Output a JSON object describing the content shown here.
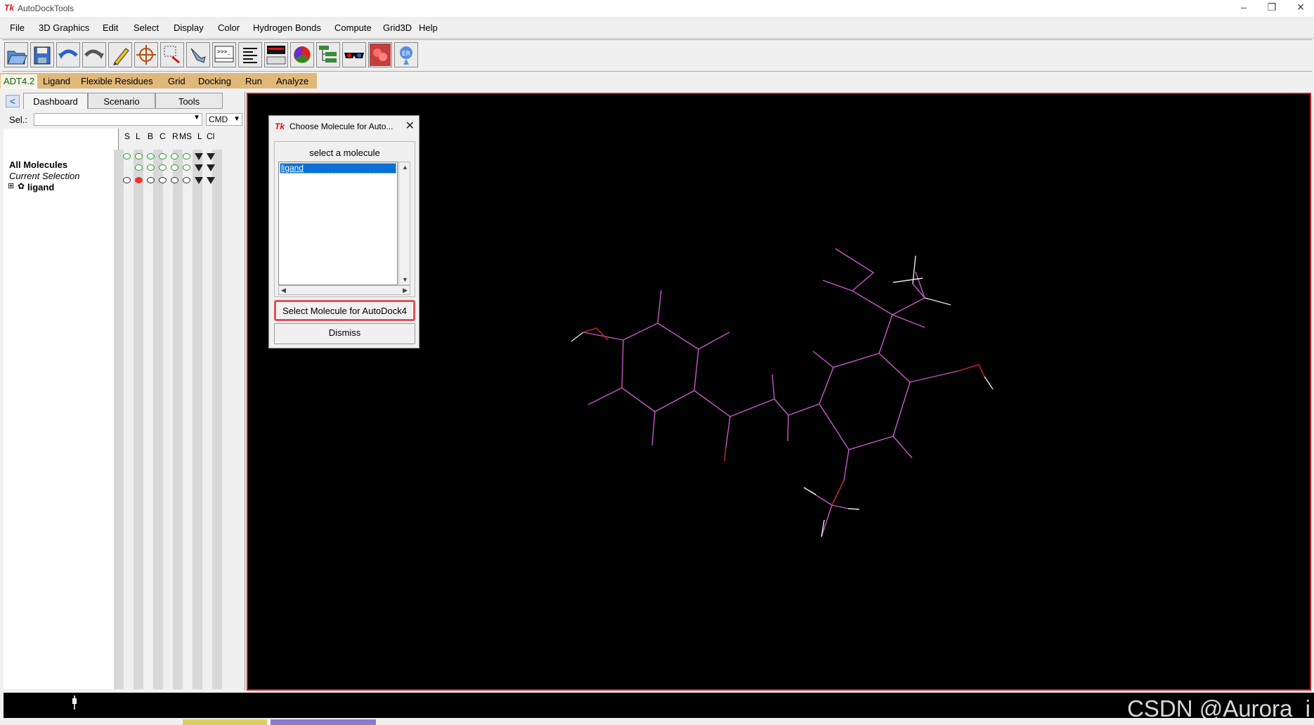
{
  "window": {
    "title": "AutoDockTools",
    "app_icon": "Tk"
  },
  "menubar": [
    "File",
    "3D Graphics",
    "Edit",
    "Select",
    "Display",
    "Color",
    "Hydrogen Bonds",
    "Compute",
    "Grid3D",
    "Help"
  ],
  "toolbar_icons": [
    "open-file-icon",
    "save-icon",
    "undo-icon",
    "redo-icon",
    "pencil-icon",
    "crosshair-icon",
    "select-region-icon",
    "pick-hand-icon",
    "python-shell-icon",
    "text-align-icon",
    "display-panel-icon",
    "color-sphere-icon",
    "hierarchy-icon",
    "stereo-glasses-icon",
    "red-molecule-icon",
    "info-icon"
  ],
  "adt_menu": {
    "version": "ADT4.2",
    "items": [
      "Ligand",
      "Flexible Residues",
      "Grid",
      "Docking",
      "Run",
      "Analyze"
    ]
  },
  "dashboard": {
    "tabs": [
      "Dashboard",
      "Scenario",
      "Tools"
    ],
    "sel_label": "Sel.:",
    "sel_value": "",
    "cmd_value": "CMD",
    "columns": [
      "S",
      "L",
      "B",
      "C",
      "R",
      "MS",
      "L",
      "Cl"
    ],
    "tree": [
      {
        "label": "All Molecules",
        "style": "bold"
      },
      {
        "label": "Current Selection",
        "style": "italic"
      },
      {
        "label": "ligand",
        "style": "bold",
        "expander": "⊞"
      }
    ]
  },
  "dialog": {
    "title": "Choose Molecule for Auto...",
    "group_label": "select a molecule",
    "list_items": [
      "ligand"
    ],
    "select_button": "Select Molecule for AutoDock4",
    "dismiss_button": "Dismiss"
  },
  "watermark": "CSDN @Aurora_i",
  "colors": {
    "viewer_bg": "#000000",
    "viewer_border": "#c41d1d",
    "bond_color": "#c659c6",
    "oxygen_color": "#c02020",
    "hydrogen_color": "#dddddd",
    "adt_bar": "#e0b87a",
    "list_selection": "#0a6fd6"
  }
}
